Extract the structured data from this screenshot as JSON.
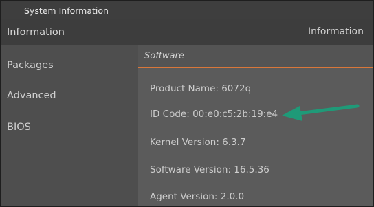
{
  "window": {
    "title": "System Information"
  },
  "sidebar": {
    "items": [
      {
        "label": "Information"
      },
      {
        "label": "Packages"
      },
      {
        "label": "Advanced"
      },
      {
        "label": "BIOS"
      }
    ]
  },
  "header": {
    "breadcrumb": "Information"
  },
  "main": {
    "section_title": "Software",
    "fields": [
      {
        "text": "Product Name: 6072q"
      },
      {
        "text": "ID Code: 00:e0:c5:2b:19:e4"
      },
      {
        "text": "Kernel Version: 6.3.7"
      },
      {
        "text": "Software Version: 16.5.36"
      },
      {
        "text": "Agent Version: 2.0.0"
      }
    ]
  },
  "annotation": {
    "icon": "arrow-icon",
    "color": "#1f9a78"
  },
  "colors": {
    "accent": "#d9773a"
  }
}
